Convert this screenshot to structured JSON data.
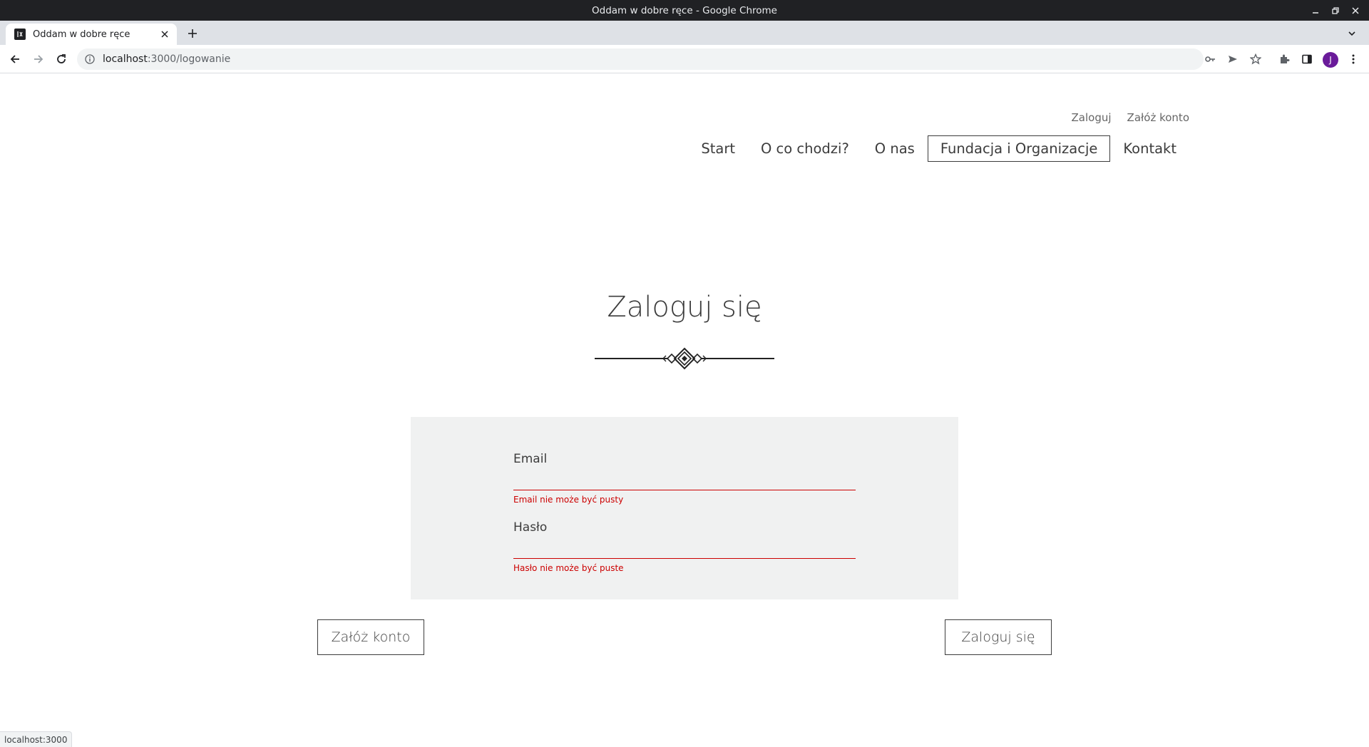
{
  "window": {
    "title": "Oddam w dobre ręce - Google Chrome"
  },
  "tab": {
    "title": "Oddam w dobre ręce"
  },
  "address": {
    "host": "localhost",
    "path": ":3000/logowanie"
  },
  "profile": {
    "initial": "J",
    "color": "#6a1b9a"
  },
  "header": {
    "top_links": {
      "login": "Zaloguj",
      "register": "Załóż konto"
    },
    "nav": [
      {
        "label": "Start",
        "active": false
      },
      {
        "label": "O co chodzi?",
        "active": false
      },
      {
        "label": "O nas",
        "active": false
      },
      {
        "label": "Fundacja i Organizacje",
        "active": true
      },
      {
        "label": "Kontakt",
        "active": false
      }
    ]
  },
  "login": {
    "title": "Zaloguj się",
    "email": {
      "label": "Email",
      "value": "",
      "error": "Email nie może być pusty"
    },
    "password": {
      "label": "Hasło",
      "value": "",
      "error": "Hasło nie może być puste"
    },
    "register_button": "Załóż konto",
    "submit_button": "Zaloguj się"
  },
  "colors": {
    "error": "#cc0000",
    "form_bg": "#f0f1f1",
    "text": "#3c3c3c"
  },
  "status_bar": "localhost:3000"
}
